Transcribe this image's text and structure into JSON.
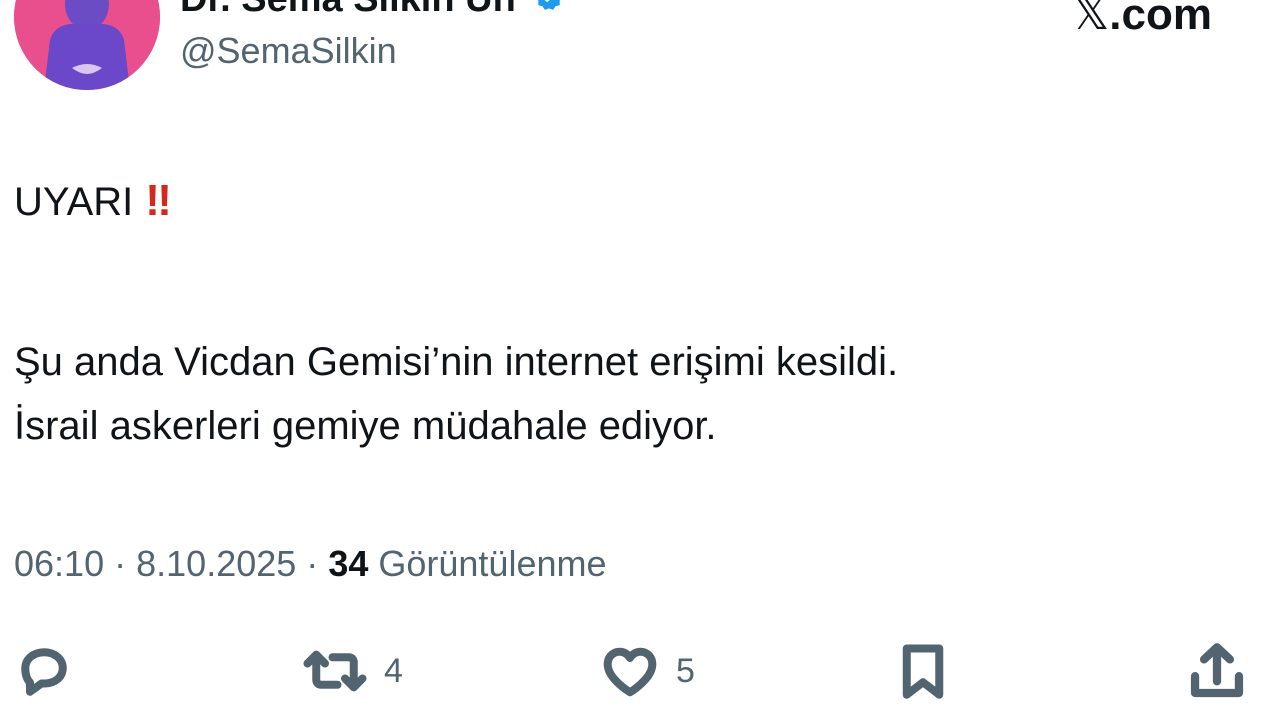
{
  "author": {
    "display_name": "Dr. Sema Silkin Un",
    "handle": "@SemaSilkin",
    "verified": true,
    "avatar_color": "#e94f8c"
  },
  "brand": {
    "x_mark": "𝕏",
    "suffix": ".com"
  },
  "tweet": {
    "warning_text": "UYARI",
    "warning_emoji": "‼",
    "lines": [
      "Şu anda Vicdan Gemisi’nin internet erişimi kesildi.",
      "İsrail askerleri gemiye müdahale ediyor."
    ]
  },
  "meta": {
    "time": "06:10",
    "separator": "·",
    "date": "8.10.2025",
    "views_count": "34",
    "views_label": "Görüntülenme"
  },
  "actions": {
    "reply": {
      "icon": "reply-icon",
      "count": ""
    },
    "retweet": {
      "icon": "retweet-icon",
      "count": "4"
    },
    "like": {
      "icon": "heart-icon",
      "count": "5"
    },
    "bookmark": {
      "icon": "bookmark-icon",
      "count": ""
    },
    "share": {
      "icon": "share-icon",
      "count": ""
    }
  },
  "colors": {
    "text_primary": "#0f1419",
    "text_secondary": "#536471",
    "warning_red": "#d9261c",
    "verified_blue": "#1d9bf0"
  }
}
